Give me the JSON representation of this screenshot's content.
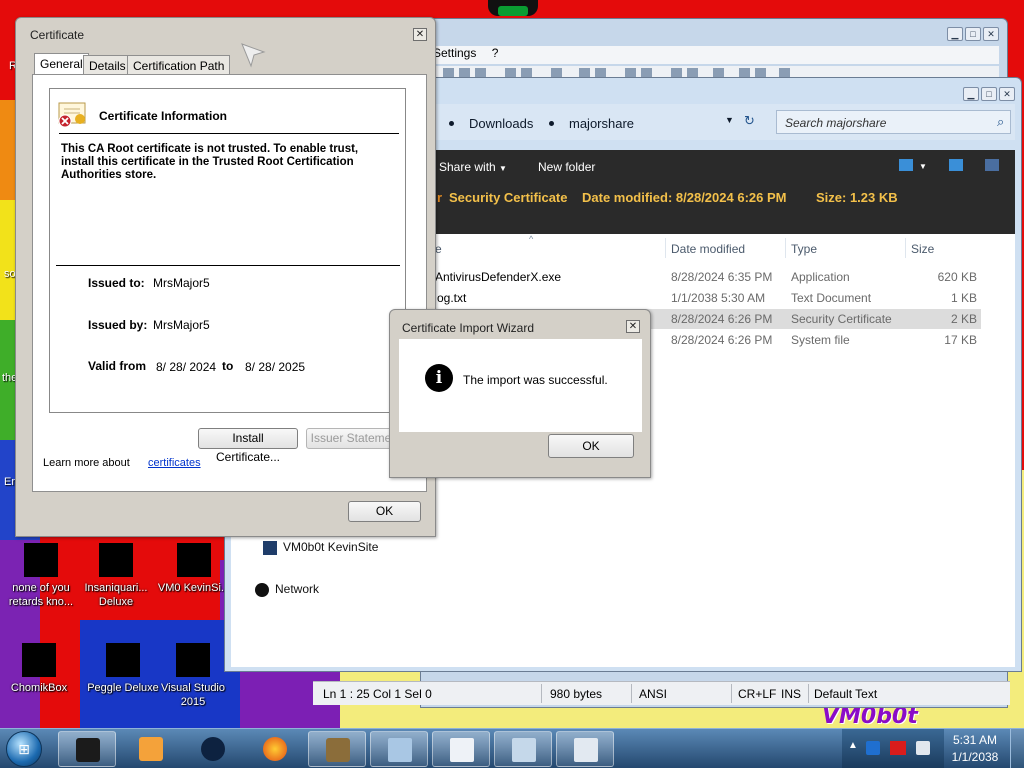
{
  "desktop": {
    "overlay_text": [
      "R",
      "so",
      "the",
      "En"
    ],
    "watermark": "VM0b0t",
    "icons": [
      {
        "label": "none of you retards kno..."
      },
      {
        "label": "Insaniquari... Deluxe"
      },
      {
        "label": "VM0 KevinSi..."
      },
      {
        "label": "ChomikBox"
      },
      {
        "label": "Peggle Deluxe"
      },
      {
        "label": "Visual Studio 2015"
      }
    ]
  },
  "notepad": {
    "menu": [
      "Settings",
      "?"
    ],
    "statusbar": {
      "position": "Ln 1 : 25   Col 1   Sel 0",
      "size": "980 bytes",
      "encoding": "ANSI",
      "line_endings": "CR+LF",
      "mode": "INS",
      "scheme": "Default Text"
    }
  },
  "explorer": {
    "breadcrumb": [
      "Downloads",
      "majorshare"
    ],
    "search_placeholder": "Search majorshare",
    "commands": [
      "Share with",
      "New folder"
    ],
    "details": {
      "name": "Security Certificate",
      "modified": "Date modified: 8/28/2024 6:26 PM",
      "size": "Size: 1.23 KB"
    },
    "columns": {
      "name": "e",
      "date": "Date modified",
      "type": "Type",
      "size": "Size"
    },
    "files": [
      {
        "name": "AntivirusDefenderX.exe",
        "date": "8/28/2024 6:35 PM",
        "type": "Application",
        "size": "620 KB"
      },
      {
        "name": "og.txt",
        "date": "1/1/2038 5:30 AM",
        "type": "Text Document",
        "size": "1 KB"
      },
      {
        "name": "",
        "date": "8/28/2024 6:26 PM",
        "type": "Security Certificate",
        "size": "2 KB"
      },
      {
        "name": "",
        "date": "8/28/2024 6:26 PM",
        "type": "System file",
        "size": "17 KB"
      }
    ],
    "nav": [
      "VM0b0t KevinSite",
      "Network"
    ]
  },
  "certificate": {
    "title": "Certificate",
    "tabs": [
      "General",
      "Details",
      "Certification Path"
    ],
    "info_heading": "Certificate Information",
    "warning": "This CA Root certificate is not trusted. To enable trust, install this certificate in the Trusted Root Certification Authorities store.",
    "issued_to_label": "Issued to:",
    "issued_to": "MrsMajor5",
    "issued_by_label": "Issued by:",
    "issued_by": "MrsMajor5",
    "valid_from_label": "Valid from",
    "valid_from": "8/ 28/ 2024",
    "to_label": "to",
    "valid_to": "8/ 28/ 2025",
    "install_button": "Install Certificate...",
    "issuer_button": "Issuer Statement",
    "learn_more": "Learn more about",
    "learn_link": "certificates",
    "ok_button": "OK"
  },
  "wizard": {
    "title": "Certificate Import Wizard",
    "message": "The import was successful.",
    "ok_button": "OK"
  },
  "taskbar": {
    "clock_time": "5:31 AM",
    "clock_date": "1/1/2038"
  }
}
